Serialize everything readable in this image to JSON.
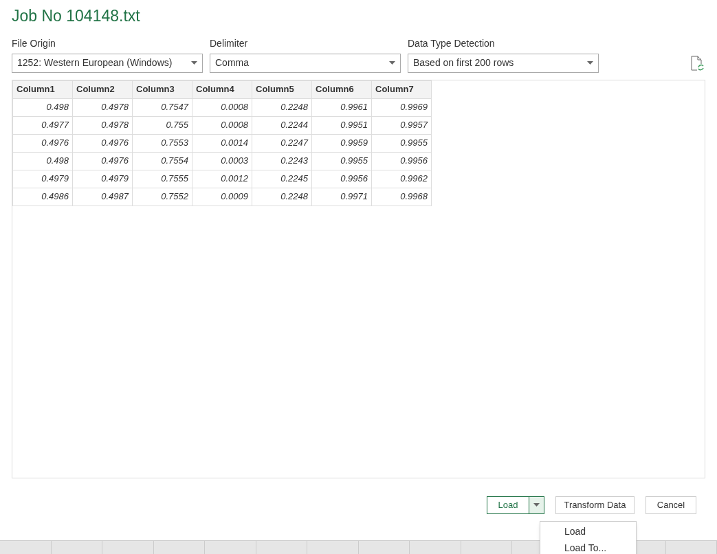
{
  "window": {
    "title": "Job No 104148.txt"
  },
  "options": [
    {
      "label": "File Origin",
      "value": "1252: Western European (Windows)"
    },
    {
      "label": "Delimiter",
      "value": "Comma"
    },
    {
      "label": "Data Type Detection",
      "value": "Based on first 200 rows"
    }
  ],
  "table": {
    "columns": [
      "Column1",
      "Column2",
      "Column3",
      "Column4",
      "Column5",
      "Column6",
      "Column7"
    ],
    "rows": [
      [
        "0.498",
        "0.4978",
        "0.7547",
        "0.0008",
        "0.2248",
        "0.9961",
        "0.9969"
      ],
      [
        "0.4977",
        "0.4978",
        "0.755",
        "0.0008",
        "0.2244",
        "0.9951",
        "0.9957"
      ],
      [
        "0.4976",
        "0.4976",
        "0.7553",
        "0.0014",
        "0.2247",
        "0.9959",
        "0.9955"
      ],
      [
        "0.498",
        "0.4976",
        "0.7554",
        "0.0003",
        "0.2243",
        "0.9955",
        "0.9956"
      ],
      [
        "0.4979",
        "0.4979",
        "0.7555",
        "0.0012",
        "0.2245",
        "0.9956",
        "0.9962"
      ],
      [
        "0.4986",
        "0.4987",
        "0.7552",
        "0.0009",
        "0.2248",
        "0.9971",
        "0.9968"
      ]
    ]
  },
  "buttons": {
    "load": "Load",
    "transform": "Transform Data",
    "cancel": "Cancel"
  },
  "load_menu": {
    "expanded": true,
    "items": [
      "Load",
      "Load To..."
    ]
  }
}
